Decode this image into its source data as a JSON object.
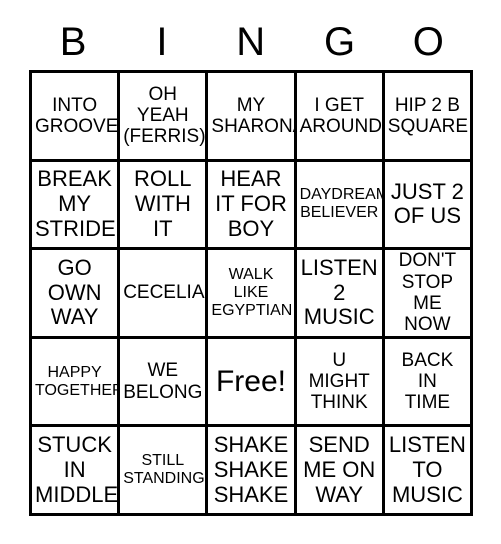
{
  "card": {
    "header_letters": [
      "B",
      "I",
      "N",
      "G",
      "O"
    ],
    "free_space_label": "Free!",
    "rows": [
      [
        {
          "text": "INTO\nGROOVE",
          "size": "md"
        },
        {
          "text": "OH\nYEAH\n(FERRIS)",
          "size": "md"
        },
        {
          "text": "MY\nSHARONA",
          "size": "md"
        },
        {
          "text": "I GET\nAROUND",
          "size": "md"
        },
        {
          "text": "HIP 2 B\nSQUARE",
          "size": "md"
        }
      ],
      [
        {
          "text": "BREAK\nMY\nSTRIDE",
          "size": "lg"
        },
        {
          "text": "ROLL\nWITH\nIT",
          "size": "lg"
        },
        {
          "text": "HEAR\nIT FOR\nBOY",
          "size": "lg"
        },
        {
          "text": "DAYDREAM\nBELIEVER",
          "size": "sm"
        },
        {
          "text": "JUST 2\nOF US",
          "size": "lg"
        }
      ],
      [
        {
          "text": "GO\nOWN\nWAY",
          "size": "lg"
        },
        {
          "text": "CECELIA",
          "size": "md"
        },
        {
          "text": "WALK\nLIKE\nEGYPTIAN",
          "size": "sm"
        },
        {
          "text": "LISTEN\n2\nMUSIC",
          "size": "lg"
        },
        {
          "text": "DON'T\nSTOP\nME NOW",
          "size": "md"
        }
      ],
      [
        {
          "text": "HAPPY\nTOGETHER",
          "size": "sm"
        },
        {
          "text": "WE\nBELONG",
          "size": "md"
        },
        {
          "text": "Free!",
          "size": "xl",
          "free": true
        },
        {
          "text": "U\nMIGHT\nTHINK",
          "size": "md"
        },
        {
          "text": "BACK\nIN\nTIME",
          "size": "md"
        }
      ],
      [
        {
          "text": "STUCK\nIN\nMIDDLE",
          "size": "lg"
        },
        {
          "text": "STILL\nSTANDING",
          "size": "sm"
        },
        {
          "text": "SHAKE\nSHAKE\nSHAKE",
          "size": "lg"
        },
        {
          "text": "SEND\nME ON\nWAY",
          "size": "lg"
        },
        {
          "text": "LISTEN\nTO\nMUSIC",
          "size": "lg"
        }
      ]
    ]
  },
  "colors": {
    "background": "#ffffff",
    "ink": "#000000",
    "grid_line": "#000000"
  }
}
